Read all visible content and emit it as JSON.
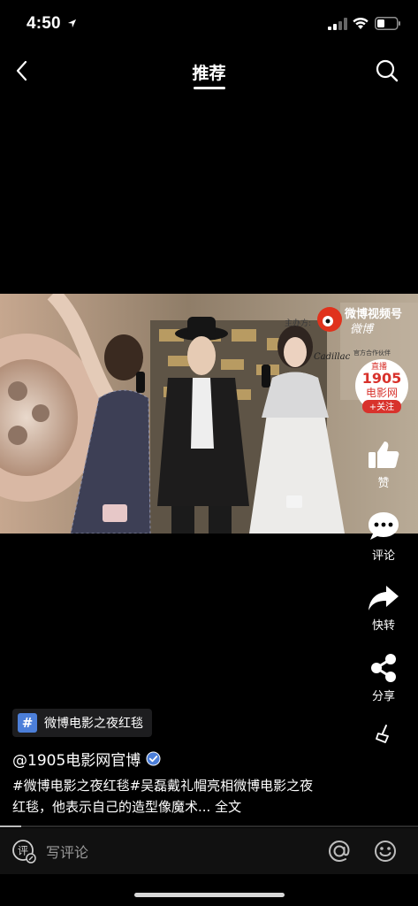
{
  "status_bar": {
    "time": "4:50"
  },
  "nav": {
    "title": "推荐"
  },
  "video": {
    "overlay_watermark": "微博视频号",
    "overlay_watermark_script": "微博",
    "badge_top": "直播",
    "badge_number": "1905",
    "badge_name": "电影网",
    "badge_follow": "+关注",
    "sign_text_1": "主办方:",
    "sign_text_2": "官方合作伙伴",
    "sign_text_3": "Cadillac"
  },
  "actions": {
    "like_label": "赞",
    "comment_label": "评论",
    "share_label": "快转",
    "forward_label": "分享"
  },
  "post": {
    "topic": "微博电影之夜红毯",
    "topic_symbol": "#",
    "author": "@1905电影网官博",
    "description": "#微博电影之夜红毯#吴磊戴礼帽亮相微博电影之夜红毯，他表示自己的造型像魔术... 全文",
    "progress_fraction": 0.05
  },
  "comment_bar": {
    "placeholder": "写评论"
  },
  "colors": {
    "accent_blue": "#4c7fd9",
    "badge_red": "#d8322c",
    "background": "#000000"
  }
}
